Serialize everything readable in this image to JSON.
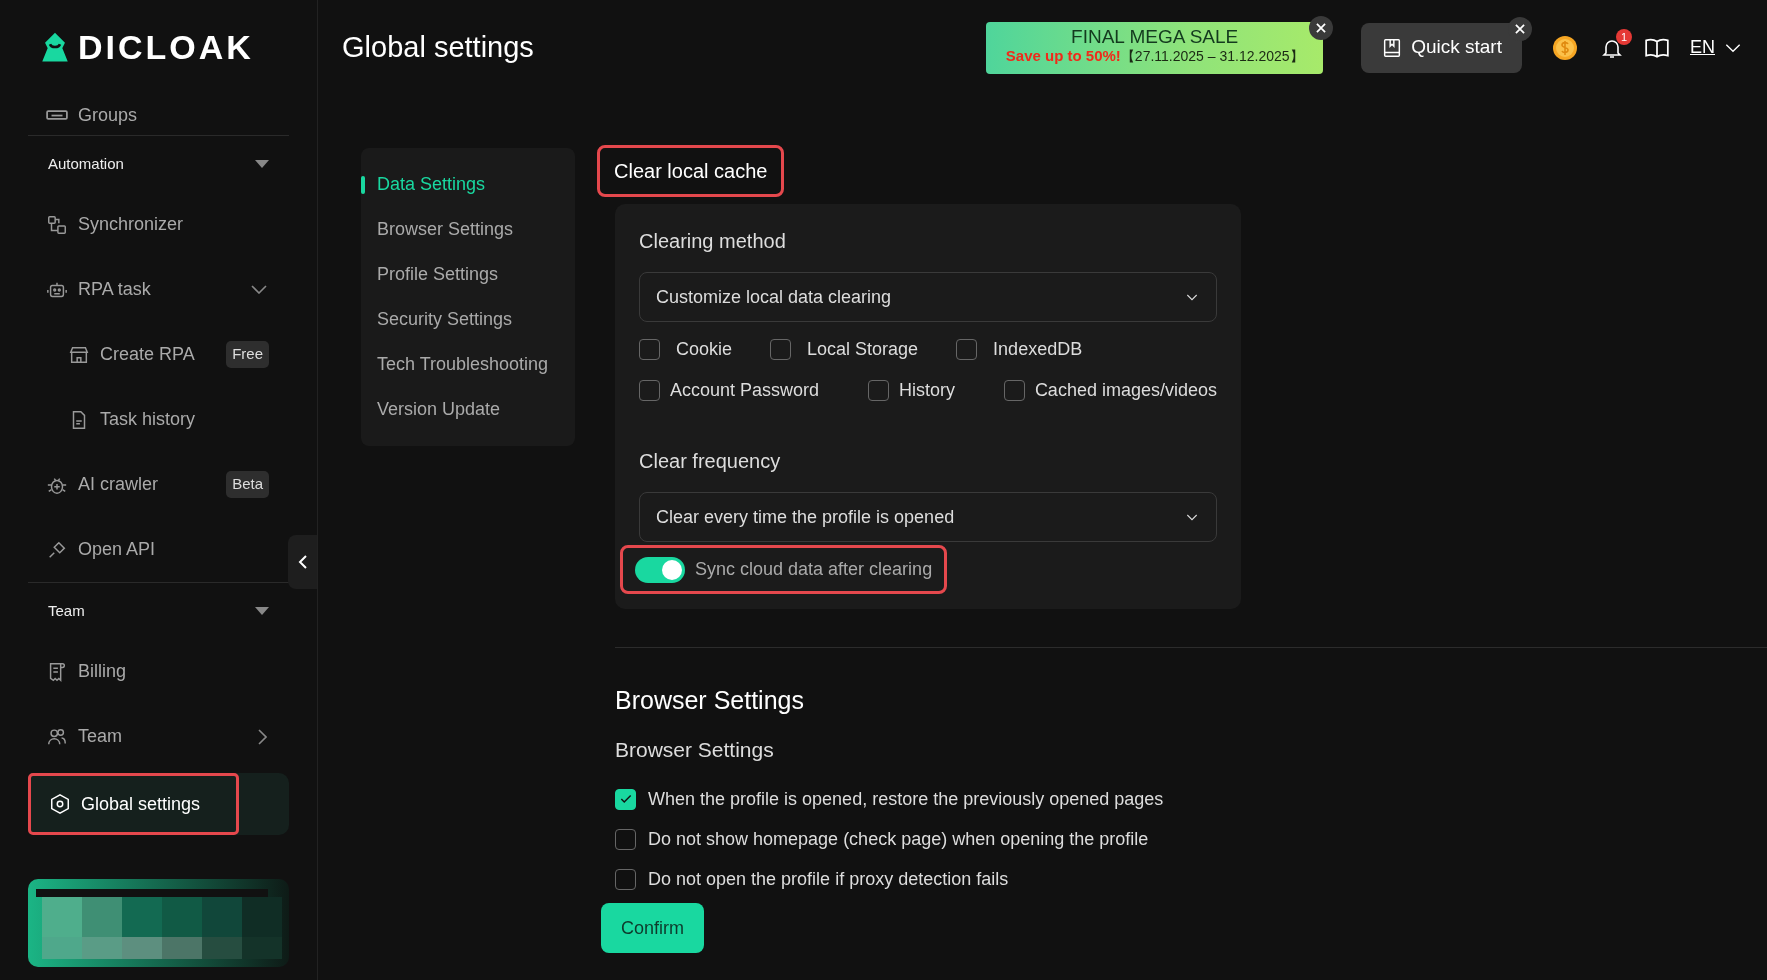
{
  "sidebar": {
    "logo": "DICLOAK",
    "items": [
      {
        "kind": "item",
        "label": "Groups"
      },
      {
        "kind": "divider"
      },
      {
        "kind": "section",
        "label": "Automation",
        "expanded": true
      },
      {
        "kind": "item",
        "label": "Synchronizer"
      },
      {
        "kind": "item",
        "label": "RPA task",
        "expanded": true
      },
      {
        "kind": "subitem",
        "label": "Create RPA",
        "badge": "Free"
      },
      {
        "kind": "subitem",
        "label": "Task history"
      },
      {
        "kind": "item",
        "label": "AI crawler",
        "badge": "Beta"
      },
      {
        "kind": "item",
        "label": "Open API"
      },
      {
        "kind": "divider"
      },
      {
        "kind": "section",
        "label": "Team",
        "expanded": true
      },
      {
        "kind": "item",
        "label": "Billing"
      },
      {
        "kind": "item",
        "label": "Team",
        "expanded": false
      },
      {
        "kind": "item",
        "label": "Global settings",
        "selected": true,
        "highlighted": true
      }
    ]
  },
  "header": {
    "title": "Global settings",
    "sale": {
      "title": "FINAL MEGA SALE",
      "offer": "Save up to 50%!",
      "dates": "【27.11.2025 – 31.12.2025】"
    },
    "quick_start": "Quick start",
    "notifications": "1",
    "language": "EN"
  },
  "settings_nav": [
    {
      "label": "Data Settings",
      "selected": true
    },
    {
      "label": "Browser Settings",
      "selected": false
    },
    {
      "label": "Profile Settings",
      "selected": false
    },
    {
      "label": "Security Settings",
      "selected": false
    },
    {
      "label": "Tech Troubleshooting",
      "selected": false
    },
    {
      "label": "Version Update",
      "selected": false
    }
  ],
  "clear_cache": {
    "title": "Clear local cache",
    "highlighted": true,
    "method_label": "Clearing method",
    "method_value": "Customize local data clearing",
    "data_types": [
      [
        {
          "label": "Cookie",
          "checked": false
        },
        {
          "label": "Local Storage",
          "checked": false
        },
        {
          "label": "IndexedDB",
          "checked": false
        }
      ],
      [
        {
          "label": "Account Password",
          "checked": false
        },
        {
          "label": "History",
          "checked": false
        },
        {
          "label": "Cached images/videos",
          "checked": false
        }
      ]
    ],
    "frequency_label": "Clear frequency",
    "frequency_value": "Clear every time the profile is opened",
    "sync": {
      "label": "Sync cloud data after clearing",
      "on": true,
      "highlighted": true
    }
  },
  "browser_settings": {
    "heading": "Browser Settings",
    "subheading": "Browser Settings",
    "options": [
      {
        "label": "When the profile is opened, restore the previously opened pages",
        "checked": true
      },
      {
        "label": "Do not show homepage (check page) when opening the profile",
        "checked": false
      },
      {
        "label": "Do not open the profile if proxy detection fails",
        "checked": false
      }
    ]
  },
  "confirm": "Confirm"
}
